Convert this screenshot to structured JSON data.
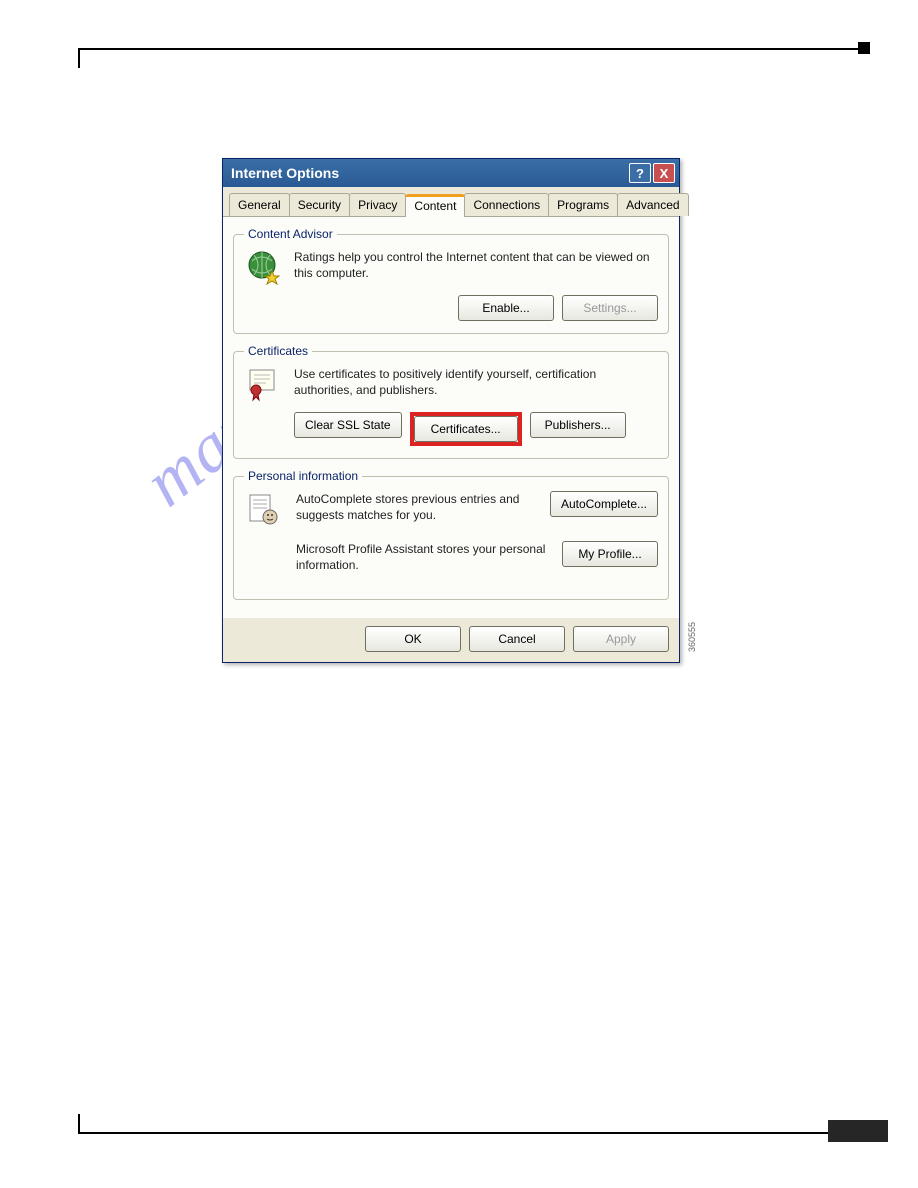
{
  "watermark": "manualshive.com",
  "side_label": "360555",
  "dialog": {
    "title": "Internet Options",
    "help_symbol": "?",
    "close_symbol": "X",
    "tabs": [
      "General",
      "Security",
      "Privacy",
      "Content",
      "Connections",
      "Programs",
      "Advanced"
    ],
    "active_tab": "Content",
    "content_advisor": {
      "legend": "Content Advisor",
      "desc": "Ratings help you control the Internet content that can be viewed on this computer.",
      "enable_btn": "Enable...",
      "settings_btn": "Settings..."
    },
    "certificates": {
      "legend": "Certificates",
      "desc": "Use certificates to positively identify yourself, certification authorities, and publishers.",
      "clear_btn": "Clear SSL State",
      "cert_btn": "Certificates...",
      "pub_btn": "Publishers..."
    },
    "personal_info": {
      "legend": "Personal information",
      "autocomplete_desc": "AutoComplete stores previous entries and suggests matches for you.",
      "autocomplete_btn": "AutoComplete...",
      "profile_desc": "Microsoft Profile Assistant stores your personal information.",
      "profile_btn": "My Profile..."
    },
    "footer": {
      "ok": "OK",
      "cancel": "Cancel",
      "apply": "Apply"
    }
  }
}
